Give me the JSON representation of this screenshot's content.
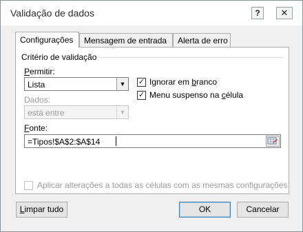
{
  "window": {
    "title": "Validação de dados",
    "help_glyph": "?",
    "close_glyph": "✕"
  },
  "tabs": [
    {
      "label": "Configurações",
      "active": true
    },
    {
      "label": "Mensagem de entrada",
      "active": false
    },
    {
      "label": "Alerta de erro",
      "active": false
    }
  ],
  "settings": {
    "group_label": "Critério de validação",
    "allow": {
      "label_pre": "",
      "label_accel": "P",
      "label_post": "ermitir:",
      "value": "Lista"
    },
    "data": {
      "label": "Dados:",
      "value": "está entre",
      "enabled": false
    },
    "ignore_blank": {
      "checked": true,
      "label_pre": "Ignorar em ",
      "label_accel": "b",
      "label_post": "ranco"
    },
    "in_cell_dropdown": {
      "checked": true,
      "label_pre": "Menu suspenso na ",
      "label_accel": "c",
      "label_post": "élula"
    },
    "source": {
      "label_accel": "F",
      "label_post": "onte:",
      "value": "=Tipos!$A$2:$A$14"
    },
    "apply_all": {
      "checked": false,
      "enabled": false,
      "label": "Aplicar alterações a todas as células com as mesmas configurações"
    }
  },
  "buttons": {
    "clear_all_accel": "L",
    "clear_all_post": "impar tudo",
    "ok": "OK",
    "cancel": "Cancelar"
  },
  "glyphs": {
    "check": "✓",
    "dropdown_arrow": "▼"
  }
}
